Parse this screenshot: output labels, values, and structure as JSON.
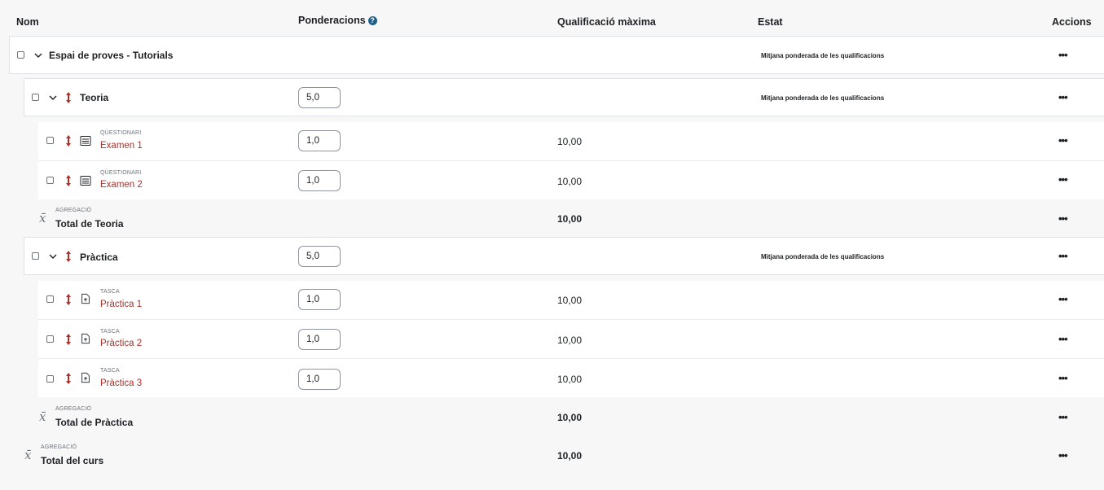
{
  "header": {
    "name": "Nom",
    "weights": "Ponderacions",
    "weights_help": "?",
    "max_grade": "Qualificació màxima",
    "status": "Estat",
    "actions": "Accions"
  },
  "course": {
    "name": "Espai de proves - Tutorials",
    "status": "Mitjana ponderada de les qualificacions",
    "actions": "•••"
  },
  "categories": [
    {
      "name": "Teoria",
      "weight": "5,0",
      "status": "Mitjana ponderada de les qualificacions",
      "actions": "•••",
      "items": [
        {
          "type_label": "QÜESTIONARI",
          "type_icon": "quiz-icon",
          "name": "Examen 1",
          "weight": "1,0",
          "max": "10,00",
          "actions": "•••"
        },
        {
          "type_label": "QÜESTIONARI",
          "type_icon": "quiz-icon",
          "name": "Examen 2",
          "weight": "1,0",
          "max": "10,00",
          "actions": "•••"
        }
      ],
      "total": {
        "type_label": "AGREGACIÓ",
        "name": "Total de Teoria",
        "max": "10,00",
        "actions": "•••"
      }
    },
    {
      "name": "Pràctica",
      "weight": "5,0",
      "status": "Mitjana ponderada de les qualificacions",
      "actions": "•••",
      "items": [
        {
          "type_label": "TASCA",
          "type_icon": "assignment-icon",
          "name": "Pràctica 1",
          "weight": "1,0",
          "max": "10,00",
          "actions": "•••"
        },
        {
          "type_label": "TASCA",
          "type_icon": "assignment-icon",
          "name": "Pràctica 2",
          "weight": "1,0",
          "max": "10,00",
          "actions": "•••"
        },
        {
          "type_label": "TASCA",
          "type_icon": "assignment-icon",
          "name": "Pràctica 3",
          "weight": "1,0",
          "max": "10,00",
          "actions": "•••"
        }
      ],
      "total": {
        "type_label": "AGREGACIÓ",
        "name": "Total de Pràctica",
        "max": "10,00",
        "actions": "•••"
      }
    }
  ],
  "course_total": {
    "type_label": "AGREGACIÓ",
    "name": "Total del curs",
    "max": "10,00",
    "actions": "•••"
  },
  "colors": {
    "link": "#b0302a",
    "move_icon": "#b0302a",
    "help_icon": "#1f5f8b"
  }
}
